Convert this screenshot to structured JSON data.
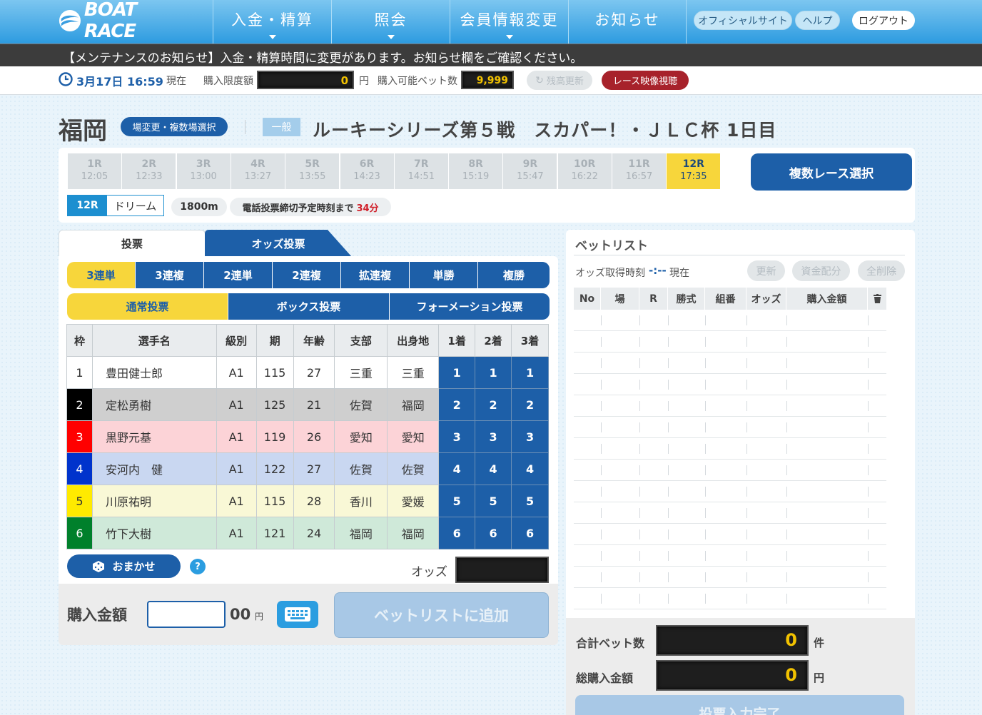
{
  "header": {
    "logo_text": "BOAT RACE",
    "nav": [
      "入金・精算",
      "照会",
      "会員情報変更",
      "お知らせ"
    ],
    "official_site": "オフィシャルサイト",
    "help": "ヘルプ",
    "logout": "ログアウト"
  },
  "maintenance_notice": "【メンテナンスのお知らせ】入金・精算時間に変更があります。お知らせ欄をご確認ください。",
  "infobar": {
    "datetime": "3月17日 16:59",
    "now_suffix": "現在",
    "limit_label": "購入限度額",
    "limit_value": "0",
    "yen": "円",
    "bets_label": "購入可能ベット数",
    "bets_value": "9,999",
    "refresh_balance": "残高更新",
    "watch_video": "レース映像視聴"
  },
  "race": {
    "venue": "福岡",
    "change_venue": "場変更・複数場選択",
    "grade": "一般",
    "title": "ルーキーシリーズ第５戦　スカパー！・ＪＬＣ杯 1日目",
    "tabs": [
      {
        "r": "1R",
        "t": "12:05"
      },
      {
        "r": "2R",
        "t": "12:33"
      },
      {
        "r": "3R",
        "t": "13:00"
      },
      {
        "r": "4R",
        "t": "13:27"
      },
      {
        "r": "5R",
        "t": "13:55"
      },
      {
        "r": "6R",
        "t": "14:23"
      },
      {
        "r": "7R",
        "t": "14:51"
      },
      {
        "r": "8R",
        "t": "15:19"
      },
      {
        "r": "9R",
        "t": "15:47"
      },
      {
        "r": "10R",
        "t": "16:22"
      },
      {
        "r": "11R",
        "t": "16:57"
      },
      {
        "r": "12R",
        "t": "17:35"
      }
    ],
    "multi_race": "複数レース選択",
    "current_race": "12R",
    "race_name": "ドリーム",
    "distance": "1800m",
    "deadline_label": "電話投票締切予定時刻まで",
    "deadline_value": "34分"
  },
  "vote": {
    "tab_vote": "投票",
    "tab_odds": "オッズ投票",
    "bet_types": [
      "3連単",
      "3連複",
      "2連単",
      "2連複",
      "拡連複",
      "単勝",
      "複勝"
    ],
    "modes": [
      "通常投票",
      "ボックス投票",
      "フォーメーション投票"
    ],
    "columns": [
      "枠",
      "選手名",
      "級別",
      "期",
      "年齢",
      "支部",
      "出身地",
      "1着",
      "2着",
      "3着"
    ],
    "players": [
      {
        "waku": "1",
        "name": "豊田健士郎",
        "cls": "A1",
        "ki": "115",
        "age": "27",
        "branch": "三重",
        "home": "三重"
      },
      {
        "waku": "2",
        "name": "定松勇樹",
        "cls": "A1",
        "ki": "125",
        "age": "21",
        "branch": "佐賀",
        "home": "福岡"
      },
      {
        "waku": "3",
        "name": "黒野元基",
        "cls": "A1",
        "ki": "119",
        "age": "26",
        "branch": "愛知",
        "home": "愛知"
      },
      {
        "waku": "4",
        "name": "安河内　健",
        "cls": "A1",
        "ki": "122",
        "age": "27",
        "branch": "佐賀",
        "home": "佐賀"
      },
      {
        "waku": "5",
        "name": "川原祐明",
        "cls": "A1",
        "ki": "115",
        "age": "28",
        "branch": "香川",
        "home": "愛媛"
      },
      {
        "waku": "6",
        "name": "竹下大樹",
        "cls": "A1",
        "ki": "121",
        "age": "24",
        "branch": "福岡",
        "home": "福岡"
      }
    ],
    "omakase": "おまかせ",
    "help": "?",
    "odds_label": "オッズ",
    "amount_label": "購入金額",
    "amount_suffix": "00",
    "amount_yen": "円",
    "add_to_betlist": "ベットリストに追加"
  },
  "betlist": {
    "title": "ベットリスト",
    "odds_time_label": "オッズ取得時刻",
    "odds_time_value": "-:--",
    "now_suffix": "現在",
    "refresh": "更新",
    "allocate": "資金配分",
    "delete_all": "全削除",
    "columns": [
      "No",
      "場",
      "R",
      "勝式",
      "組番",
      "オッズ",
      "購入金額"
    ],
    "total_bets_label": "合計ベット数",
    "total_bets_value": "0",
    "total_bets_unit": "件",
    "total_amount_label": "総購入金額",
    "total_amount_value": "0",
    "total_amount_unit": "円",
    "submit": "投票入力完了"
  },
  "colors": {
    "header_top": "#7cc6f0",
    "accent_blue": "#1d5fa8",
    "accent_yellow": "#f7d63b",
    "waku": [
      "#ffffff",
      "#000000",
      "#ff0000",
      "#0033cc",
      "#ffea00",
      "#00802b"
    ],
    "row_bg": [
      "#ffffff",
      "#cfcfcf",
      "#fcd3d7",
      "#c9d7f1",
      "#f9f8d6",
      "#cfe9d9"
    ]
  }
}
